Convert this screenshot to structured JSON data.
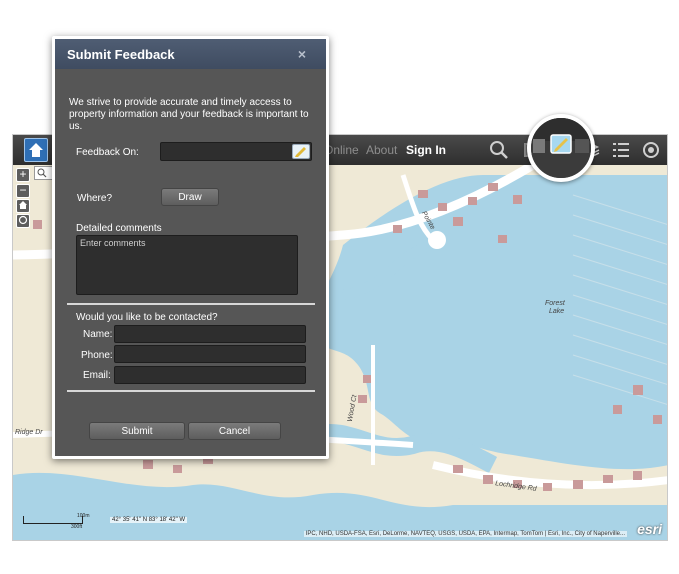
{
  "map": {
    "nav": {
      "online": "Online",
      "about": "About",
      "sign_in": "Sign In"
    },
    "road_labels": [
      "Ridge Dr",
      "Pointe",
      "Forest",
      "Lake",
      "Lochridge Rd",
      "Wood Ct"
    ],
    "coordinates": "42° 35' 41\" N  83° 18' 42\" W",
    "scale": {
      "top": "100m",
      "bottom": "300ft"
    },
    "attribution": "IPC, NHD, USDA-FSA, Esri, DeLorme, NAVTEQ, USGS, USDA, EPA, Intermap, TomTom | Esri, Inc., City of Naperville...",
    "logo_text": "esri",
    "colors": {
      "water": "#a9d3e6",
      "land": "#efe9d6",
      "road": "#ffffff",
      "building": "#c99a9a"
    }
  },
  "dialog": {
    "title": "Submit Feedback",
    "close_label": "×",
    "intro": "We strive to provide accurate and timely access to property information and your feedback is important to us.",
    "feedback_on_label": "Feedback On:",
    "feedback_on_value": "",
    "where_label": "Where?",
    "draw_button": "Draw",
    "comments_label": "Detailed comments",
    "comments_placeholder": "Enter comments",
    "contact_heading": "Would you like to be contacted?",
    "name_label": "Name:",
    "phone_label": "Phone:",
    "email_label": "Email:",
    "submit_button": "Submit",
    "cancel_button": "Cancel"
  }
}
